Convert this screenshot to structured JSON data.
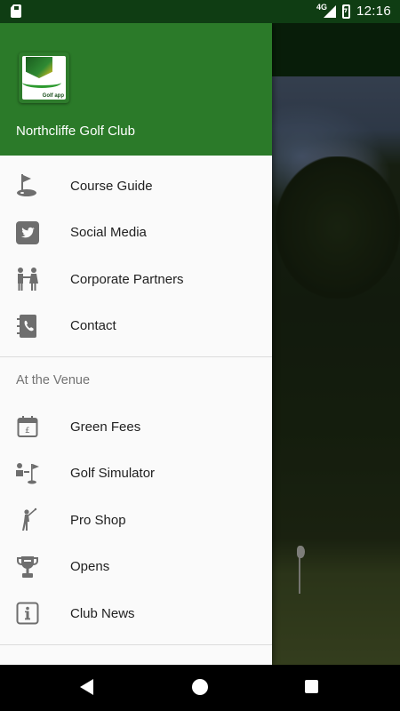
{
  "status_bar": {
    "network": "4G",
    "time": "12:16"
  },
  "drawer": {
    "club_name": "Northcliffe Golf Club",
    "logo_text": "Golf app",
    "items": [
      {
        "label": "Course Guide",
        "icon": "golf-flag-icon"
      },
      {
        "label": "Social Media",
        "icon": "twitter-icon"
      },
      {
        "label": "Corporate Partners",
        "icon": "handshake-icon"
      },
      {
        "label": "Contact",
        "icon": "address-book-icon"
      }
    ],
    "section_title": "At the Venue",
    "venue_items": [
      {
        "label": "Green Fees",
        "icon": "calendar-pound-icon"
      },
      {
        "label": "Golf Simulator",
        "icon": "golf-simulator-icon"
      },
      {
        "label": "Pro Shop",
        "icon": "golfer-icon"
      },
      {
        "label": "Opens",
        "icon": "trophy-icon"
      },
      {
        "label": "Club News",
        "icon": "info-icon"
      }
    ]
  },
  "colors": {
    "header_green": "#2b7a29",
    "status_bar": "#0f3d13",
    "drawer_bg": "#fafafa"
  }
}
